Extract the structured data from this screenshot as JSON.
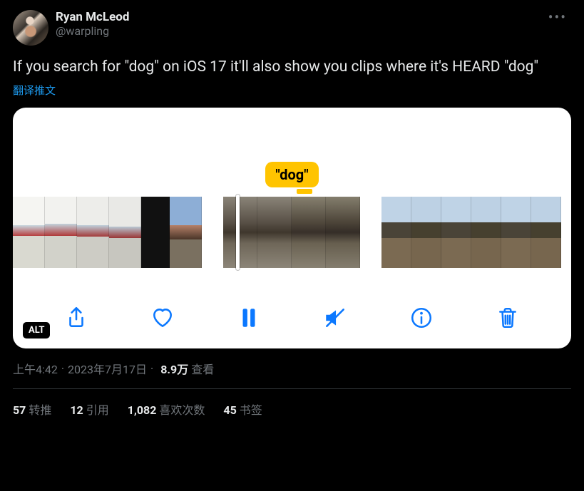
{
  "author": {
    "display_name": "Ryan McLeod",
    "handle": "@warpling"
  },
  "tweet_text": "If you search for \"dog\" on iOS 17 it'll also show you clips where it's HEARD \"dog\"",
  "translate_label": "翻译推文",
  "media": {
    "caption_bubble": "\"dog\"",
    "alt_badge": "ALT"
  },
  "meta": {
    "time": "上午4:42",
    "date": "2023年7月17日",
    "views_number": "8.9万",
    "views_label": "查看"
  },
  "stats": {
    "retweets": {
      "count": "57",
      "label": "转推"
    },
    "quotes": {
      "count": "12",
      "label": "引用"
    },
    "likes": {
      "count": "1,082",
      "label": "喜欢次数"
    },
    "bookmarks": {
      "count": "45",
      "label": "书签"
    }
  }
}
